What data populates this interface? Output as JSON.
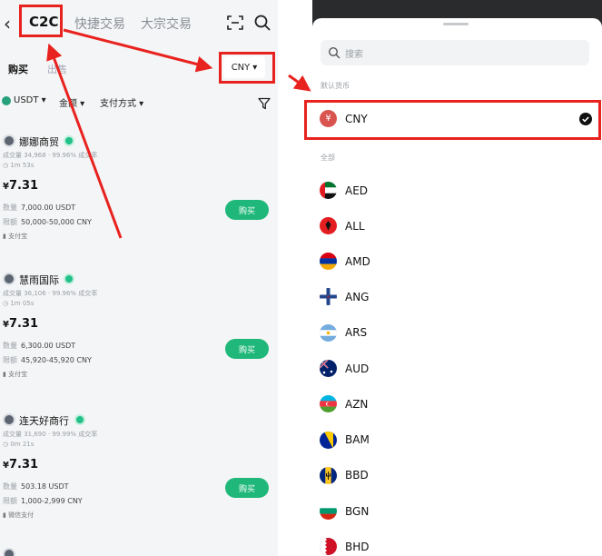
{
  "left": {
    "header": {
      "back_glyph": "‹",
      "tab_c2c": "C2C",
      "tab_quick": "快捷交易",
      "tab_bulk": "大宗交易",
      "scan_icon": "scan-icon",
      "search_icon": "search-icon"
    },
    "subtabs": {
      "buy": "购买",
      "sell": "出售"
    },
    "currency_selector": {
      "value": "CNY",
      "caret": "▾"
    },
    "filters": {
      "coin": "USDT ▾",
      "amount": "金额 ▾",
      "payment": "支付方式 ▾",
      "filter_icon": "filter-icon"
    },
    "merchants": [
      {
        "name": "娜娜商贸",
        "stats": "成交量 34,968 · 99.96% 成交率",
        "time": "◷ 1m 53s",
        "price_symbol": "¥",
        "price": "7.31",
        "qty_label": "数量",
        "qty": "7,000.00 USDT",
        "limit_label": "限额",
        "limit": "50,000-50,000 CNY",
        "pay": "▮ 支付宝",
        "buy": "购买"
      },
      {
        "name": "慧雨国际",
        "stats": "成交量 36,106 · 99.96% 成交率",
        "time": "◷ 1m 05s",
        "price_symbol": "¥",
        "price": "7.31",
        "qty_label": "数量",
        "qty": "6,300.00 USDT",
        "limit_label": "限额",
        "limit": "45,920-45,920 CNY",
        "pay": "▮ 支付宝",
        "buy": "购买"
      },
      {
        "name": "连天好商行",
        "stats": "成交量 31,690 · 99.99% 成交率",
        "time": "◷ 0m 21s",
        "price_symbol": "¥",
        "price": "7.31",
        "qty_label": "数量",
        "qty": "503.18 USDT",
        "limit_label": "限额",
        "limit": "1,000-2,999 CNY",
        "pay": "▮ 微信支付",
        "buy": "购买"
      }
    ]
  },
  "right": {
    "search_placeholder": "搜索",
    "section_default": "默认货币",
    "selected": {
      "code": "CNY",
      "symbol": "¥",
      "color": "#d9534f"
    },
    "section_all": "全部",
    "currencies": [
      {
        "code": "AED",
        "flag": "uae"
      },
      {
        "code": "ALL",
        "flag": "albania"
      },
      {
        "code": "AMD",
        "flag": "armenia"
      },
      {
        "code": "ANG",
        "flag": "curacao"
      },
      {
        "code": "ARS",
        "flag": "argentina"
      },
      {
        "code": "AUD",
        "flag": "australia"
      },
      {
        "code": "AZN",
        "flag": "azerbaijan"
      },
      {
        "code": "BAM",
        "flag": "bosnia"
      },
      {
        "code": "BBD",
        "flag": "barbados"
      },
      {
        "code": "BGN",
        "flag": "bulgaria"
      },
      {
        "code": "BHD",
        "flag": "bahrain"
      }
    ]
  },
  "colors": {
    "highlight": "#e8221f",
    "buy_green": "#20b87a",
    "brand_badge": "#22c08a"
  }
}
